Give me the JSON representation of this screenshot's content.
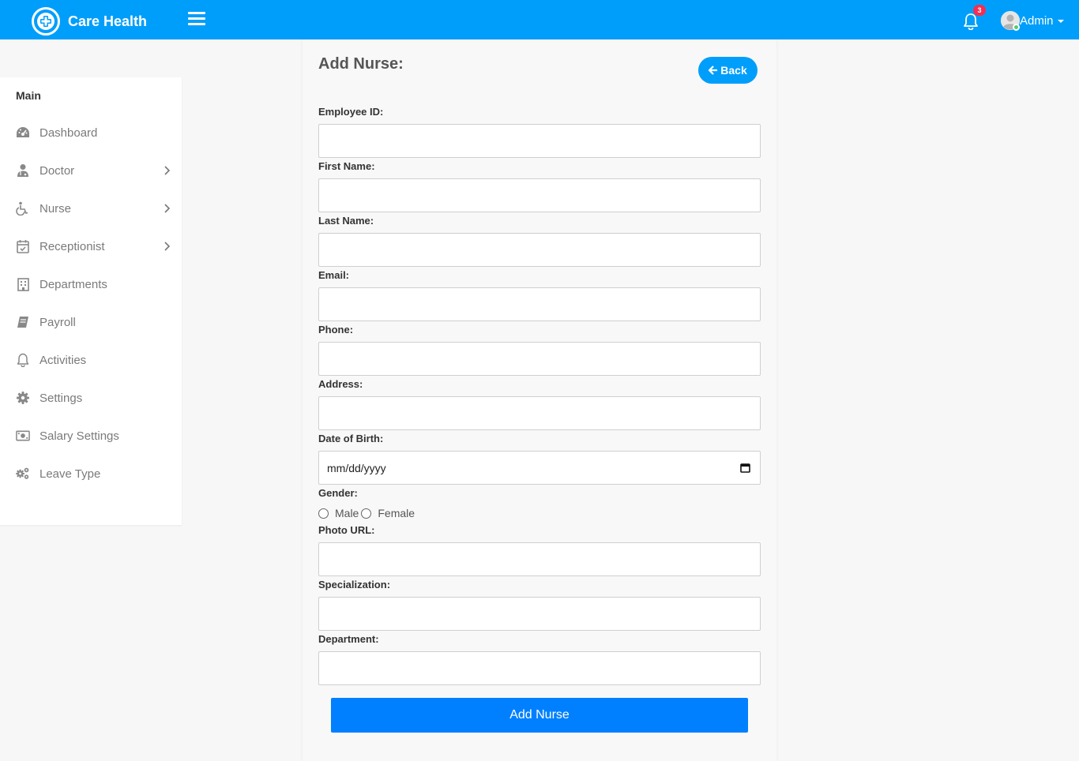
{
  "header": {
    "brand_name": "Care Health",
    "notification_count": "3",
    "user_name": "Admin"
  },
  "sidebar": {
    "title": "Main",
    "items": [
      {
        "label": "Dashboard",
        "icon": "dashboard-icon",
        "has_submenu": false
      },
      {
        "label": "Doctor",
        "icon": "doctor-icon",
        "has_submenu": true
      },
      {
        "label": "Nurse",
        "icon": "wheelchair-icon",
        "has_submenu": true
      },
      {
        "label": "Receptionist",
        "icon": "calendar-check-icon",
        "has_submenu": true
      },
      {
        "label": "Departments",
        "icon": "hospital-icon",
        "has_submenu": false
      },
      {
        "label": "Payroll",
        "icon": "book-icon",
        "has_submenu": false
      },
      {
        "label": "Activities",
        "icon": "bell-icon",
        "has_submenu": false
      },
      {
        "label": "Settings",
        "icon": "gear-icon",
        "has_submenu": false
      },
      {
        "label": "Salary Settings",
        "icon": "money-bill-icon",
        "has_submenu": false
      },
      {
        "label": "Leave Type",
        "icon": "gears-icon",
        "has_submenu": false
      }
    ]
  },
  "form": {
    "title": "Add Nurse:",
    "back_label": "Back",
    "fields": {
      "employee_id": {
        "label": "Employee ID:",
        "value": ""
      },
      "first_name": {
        "label": "First Name:",
        "value": ""
      },
      "last_name": {
        "label": "Last Name:",
        "value": ""
      },
      "email": {
        "label": "Email:",
        "value": ""
      },
      "phone": {
        "label": "Phone:",
        "value": ""
      },
      "address": {
        "label": "Address:",
        "value": ""
      },
      "dob": {
        "label": "Date of Birth:",
        "placeholder": "mm/dd/yyyy"
      },
      "gender": {
        "label": "Gender:",
        "options": [
          "Male",
          "Female"
        ]
      },
      "photo_url": {
        "label": "Photo URL:",
        "value": ""
      },
      "specialization": {
        "label": "Specialization:",
        "value": ""
      },
      "department": {
        "label": "Department:",
        "value": ""
      }
    },
    "submit_label": "Add Nurse"
  },
  "colors": {
    "header_bg": "#009efb",
    "submit_bg": "#0080ff",
    "badge_bg": "#f62d51",
    "online_dot": "#55ce63"
  }
}
